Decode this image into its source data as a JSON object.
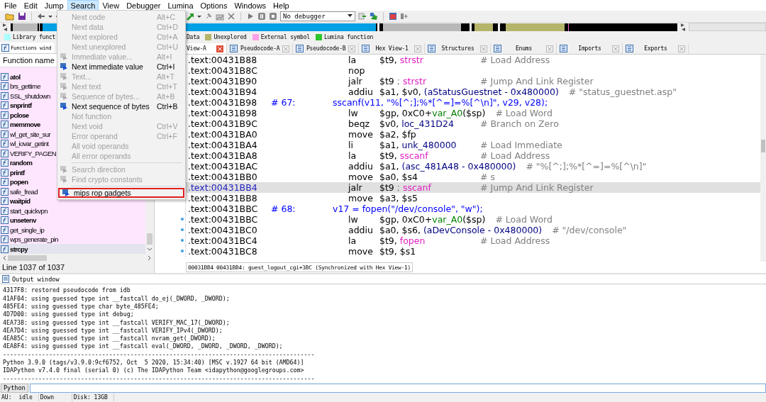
{
  "menu_bar": [
    {
      "label": "File",
      "selected": false
    },
    {
      "label": "Edit",
      "selected": false
    },
    {
      "label": "Jump",
      "selected": false
    },
    {
      "label": "Search",
      "selected": true
    },
    {
      "label": "View",
      "selected": false
    },
    {
      "label": "Debugger",
      "selected": false
    },
    {
      "label": "Lumina",
      "selected": false
    },
    {
      "label": "Options",
      "selected": false
    },
    {
      "label": "Windows",
      "selected": false
    },
    {
      "label": "Help",
      "selected": false
    }
  ],
  "search_menu": {
    "items": [
      {
        "kind": "item",
        "label": "Next code",
        "shortcut": "Alt+C",
        "disabled": true,
        "icon": false,
        "outlined": false
      },
      {
        "kind": "item",
        "label": "Next data",
        "shortcut": "Ctrl+D",
        "disabled": true,
        "icon": false,
        "outlined": false
      },
      {
        "kind": "item",
        "label": "Next explored",
        "shortcut": "Ctrl+A",
        "disabled": true,
        "icon": false,
        "outlined": false
      },
      {
        "kind": "item",
        "label": "Next unexplored",
        "shortcut": "Ctrl+U",
        "disabled": true,
        "icon": false,
        "outlined": false
      },
      {
        "kind": "item",
        "label": "Immediate value...",
        "shortcut": "Alt+I",
        "disabled": true,
        "icon": true,
        "outlined": false
      },
      {
        "kind": "item",
        "label": "Next immediate value",
        "shortcut": "Ctrl+I",
        "disabled": false,
        "icon": true,
        "outlined": false
      },
      {
        "kind": "item",
        "label": "Text...",
        "shortcut": "Alt+T",
        "disabled": true,
        "icon": true,
        "outlined": false
      },
      {
        "kind": "item",
        "label": "Next text",
        "shortcut": "Ctrl+T",
        "disabled": true,
        "icon": true,
        "outlined": false
      },
      {
        "kind": "item",
        "label": "Sequence of bytes...",
        "shortcut": "Alt+B",
        "disabled": true,
        "icon": true,
        "outlined": false
      },
      {
        "kind": "item",
        "label": "Next sequence of bytes",
        "shortcut": "Ctrl+B",
        "disabled": false,
        "icon": true,
        "outlined": false
      },
      {
        "kind": "item",
        "label": "Not function",
        "disabled": true,
        "icon": false,
        "outlined": false
      },
      {
        "kind": "item",
        "label": "Next void",
        "shortcut": "Ctrl+V",
        "disabled": true,
        "icon": false,
        "outlined": false
      },
      {
        "kind": "item",
        "label": "Error operand",
        "shortcut": "Ctrl+F",
        "disabled": true,
        "icon": false,
        "outlined": false
      },
      {
        "kind": "item",
        "label": "All void operands",
        "disabled": true,
        "icon": false,
        "outlined": false
      },
      {
        "kind": "item",
        "label": "All error operands",
        "disabled": true,
        "icon": false,
        "outlined": false
      },
      {
        "kind": "separator"
      },
      {
        "kind": "item",
        "label": "Search direction",
        "disabled": true,
        "icon": true,
        "outlined": false
      },
      {
        "kind": "item",
        "label": "Find crypto constants",
        "disabled": true,
        "icon": true,
        "outlined": false
      },
      {
        "kind": "separator"
      },
      {
        "kind": "item",
        "label": "mips rop gadgets",
        "disabled": false,
        "icon": true,
        "outlined": true
      }
    ]
  },
  "toolbar": {
    "debugger": "No debugger"
  },
  "legend": [
    {
      "label": "Library funct",
      "color": "#aaffff"
    },
    {
      "label": "Data"
    },
    {
      "label": "Unexplored",
      "color": "#b5b46b"
    },
    {
      "label": "External symbol",
      "color": "#ffa0e8"
    },
    {
      "label": "Lumina function",
      "color": "#2ec52e"
    }
  ],
  "functions_panel": {
    "tab": "Functions wind",
    "header": "Function name",
    "items": [
      {
        "name": "atol",
        "bold": true,
        "selected": false
      },
      {
        "name": "brs_gettime",
        "bold": false,
        "selected": false
      },
      {
        "name": "SSL_shutdown",
        "bold": false,
        "selected": false
      },
      {
        "name": "snprintf",
        "bold": true,
        "selected": false
      },
      {
        "name": "pclose",
        "bold": true,
        "selected": false
      },
      {
        "name": "memmove",
        "bold": true,
        "selected": false
      },
      {
        "name": "wl_get_site_sur",
        "bold": false,
        "selected": false
      },
      {
        "name": "wl_iovar_getint",
        "bold": false,
        "selected": false
      },
      {
        "name": "VERIFY_PAGEN",
        "bold": false,
        "selected": false
      },
      {
        "name": "random",
        "bold": true,
        "selected": false
      },
      {
        "name": "printf",
        "bold": true,
        "selected": false
      },
      {
        "name": "popen",
        "bold": true,
        "selected": false
      },
      {
        "name": "safe_fread",
        "bold": false,
        "selected": false
      },
      {
        "name": "waitpid",
        "bold": true,
        "selected": false
      },
      {
        "name": "start_quickvpn",
        "bold": false,
        "selected": false
      },
      {
        "name": "unsetenv",
        "bold": true,
        "selected": false
      },
      {
        "name": "get_single_ip",
        "bold": false,
        "selected": false
      },
      {
        "name": "wps_generate_pin",
        "bold": false,
        "selected": false
      },
      {
        "name": "strcpy",
        "bold": true,
        "selected": true
      }
    ],
    "footer": "Line 1037 of 1037"
  },
  "code_view": {
    "tabs": [
      {
        "label": "View-A",
        "selected": true
      },
      {
        "label": "Pseudocode-A",
        "selected": false
      },
      {
        "label": "Pseudocode-B",
        "selected": false
      },
      {
        "label": "Hex View-1",
        "selected": false
      },
      {
        "label": "Structures",
        "selected": false
      },
      {
        "label": "Enums",
        "selected": false
      },
      {
        "label": "Imports",
        "selected": false
      },
      {
        "label": "Exports",
        "selected": false
      }
    ],
    "lines": [
      {
        "kind": "insn",
        "address": ".text:00431B88",
        "mnemonic": "la",
        "operands": [
          {
            "text": "$t9, "
          },
          {
            "text": "strstr",
            "kind": "import"
          }
        ],
        "comment": "# Load Address",
        "selected": false,
        "dot": false
      },
      {
        "kind": "insn",
        "address": ".text:00431B8C",
        "mnemonic": "nop",
        "selected": false,
        "dot": false
      },
      {
        "kind": "insn",
        "address": ".text:00431B90",
        "mnemonic": "jalr",
        "operands": [
          {
            "text": "$t9 "
          },
          {
            "text": "; ",
            "kind": "comment"
          },
          {
            "text": "strstr",
            "kind": "import"
          }
        ],
        "comment": "# Jump And Link Register",
        "selected": false,
        "dot": false
      },
      {
        "kind": "insn",
        "address": ".text:00431B94",
        "mnemonic": "addiu",
        "operands": [
          {
            "text": "$a1, $v0, "
          },
          {
            "text": "(aStatusGuestnet - 0x480000)",
            "kind": "name"
          }
        ],
        "comment": "# \"status_guestnet.asp\"",
        "selected": false,
        "dot": false
      },
      {
        "kind": "source",
        "address": ".text:00431B98",
        "label": "# 67:",
        "code": "sscanf(v11, \"%[^;];%*[^=]=%[^\\n]\", v29, v28);",
        "selected": false,
        "dot": false
      },
      {
        "kind": "insn",
        "address": ".text:00431B98",
        "mnemonic": "lw",
        "operands": [
          {
            "text": "$gp, 0xC0+"
          },
          {
            "text": "var_A0",
            "kind": "stackvar"
          },
          {
            "text": "($sp)"
          }
        ],
        "comment": "# Load Word",
        "selected": false,
        "dot": false
      },
      {
        "kind": "insn",
        "address": ".text:00431B9C",
        "mnemonic": "beqz",
        "operands": [
          {
            "text": "$v0, "
          },
          {
            "text": "loc_431D24",
            "kind": "name"
          }
        ],
        "comment": "# Branch on Zero",
        "selected": false,
        "dot": false
      },
      {
        "kind": "insn",
        "address": ".text:00431BA0",
        "mnemonic": "move",
        "operands": [
          {
            "text": "$a2, $fp"
          }
        ],
        "selected": false,
        "dot": false
      },
      {
        "kind": "insn",
        "address": ".text:00431BA4",
        "mnemonic": "li",
        "operands": [
          {
            "text": "$a1, "
          },
          {
            "text": "unk_480000",
            "kind": "name"
          }
        ],
        "comment": "# Load Immediate",
        "selected": false,
        "dot": false
      },
      {
        "kind": "insn",
        "address": ".text:00431BA8",
        "mnemonic": "la",
        "operands": [
          {
            "text": "$t9, "
          },
          {
            "text": "sscanf",
            "kind": "import"
          }
        ],
        "comment": "# Load Address",
        "selected": false,
        "dot": false
      },
      {
        "kind": "insn",
        "address": ".text:00431BAC",
        "mnemonic": "addiu",
        "operands": [
          {
            "text": "$a1, "
          },
          {
            "text": "(asc_481A48 - 0x480000)",
            "kind": "name"
          }
        ],
        "comment": "# \"%[^;];%*[^=]=%[^\\n]\"",
        "selected": false,
        "dot": false
      },
      {
        "kind": "insn",
        "address": ".text:00431BB0",
        "mnemonic": "move",
        "operands": [
          {
            "text": "$a0, $s4"
          }
        ],
        "comment": "# s",
        "selected": false,
        "dot": false
      },
      {
        "kind": "insn",
        "address": ".text:00431BB4",
        "mnemonic": "jalr",
        "operands": [
          {
            "text": "$t9 "
          },
          {
            "text": "; ",
            "kind": "comment"
          },
          {
            "text": "sscanf",
            "kind": "import"
          }
        ],
        "comment": "# Jump And Link Register",
        "selected": true,
        "dot": false
      },
      {
        "kind": "insn",
        "address": ".text:00431BB8",
        "mnemonic": "move",
        "operands": [
          {
            "text": "$a3, $s5"
          }
        ],
        "selected": false,
        "dot": false
      },
      {
        "kind": "source",
        "address": ".text:00431BBC",
        "label": "# 68:",
        "code": "v17 = fopen(\"/dev/console\", \"w\");",
        "selected": false,
        "dot": false
      },
      {
        "kind": "insn",
        "address": ".text:00431BBC",
        "mnemonic": "lw",
        "operands": [
          {
            "text": "$gp, 0xC0+"
          },
          {
            "text": "var_A0",
            "kind": "stackvar"
          },
          {
            "text": "($sp)"
          }
        ],
        "comment": "# Load Word",
        "selected": false,
        "dot": true
      },
      {
        "kind": "insn",
        "address": ".text:00431BC0",
        "mnemonic": "addiu",
        "operands": [
          {
            "text": "$a0, $s6, "
          },
          {
            "text": "(aDevConsole - 0x480000)",
            "kind": "name"
          }
        ],
        "comment": "# \"/dev/console\"",
        "selected": false,
        "dot": true
      },
      {
        "kind": "insn",
        "address": ".text:00431BC4",
        "mnemonic": "la",
        "operands": [
          {
            "text": "$t9, "
          },
          {
            "text": "fopen",
            "kind": "import"
          }
        ],
        "comment": "# Load Address",
        "selected": false,
        "dot": true
      },
      {
        "kind": "insn",
        "address": ".text:00431BC8",
        "mnemonic": "move",
        "operands": [
          {
            "text": "$t9, $s1"
          }
        ],
        "selected": false,
        "dot": true
      }
    ],
    "status": {
      "offset": "00031BB4",
      "location": "00431BB4: guest_logout_cgi+3BC (Synchronized with Hex View-1)"
    }
  },
  "output": {
    "title": "Output window",
    "lines": [
      "4317F8: restored pseudocode from idb",
      "41AF04: using guessed type int __fastcall do_ej(_DWORD, _DWORD);",
      "485FE4: using guessed type char byte_485FE4;",
      "4D7D00: using guessed type int debug;",
      "4EA738: using guessed type int __fastcall VERIFY_MAC_17(_DWORD);",
      "4EA7D4: using guessed type int __fastcall VERIFY_IPv4(_DWORD);",
      "4EA85C: using guessed type int __fastcall nvram_get(_DWORD);",
      "4EA8F4: using guessed type int __fastcall eval(_DWORD, _DWORD, _DWORD, _DWORD);",
      "----------------------------------------------------------------------------------------",
      "Python 3.9.0 (tags/v3.9.0:9cf6752, Oct  5 2020, 15:34:40) [MSC v.1927 64 bit (AMD64)]",
      "IDAPython v7.4.0 final (serial 0) (c) The IDAPython Team <idapython@googlegroups.com>",
      "----------------------------------------------------------------------------------------"
    ]
  },
  "python": {
    "label": "Python"
  },
  "status_bar": [
    {
      "texts": [
        "AU:",
        "idle"
      ]
    },
    {
      "texts": [
        "Down"
      ]
    },
    {
      "texts": [
        "Disk: 13GB"
      ]
    }
  ]
}
